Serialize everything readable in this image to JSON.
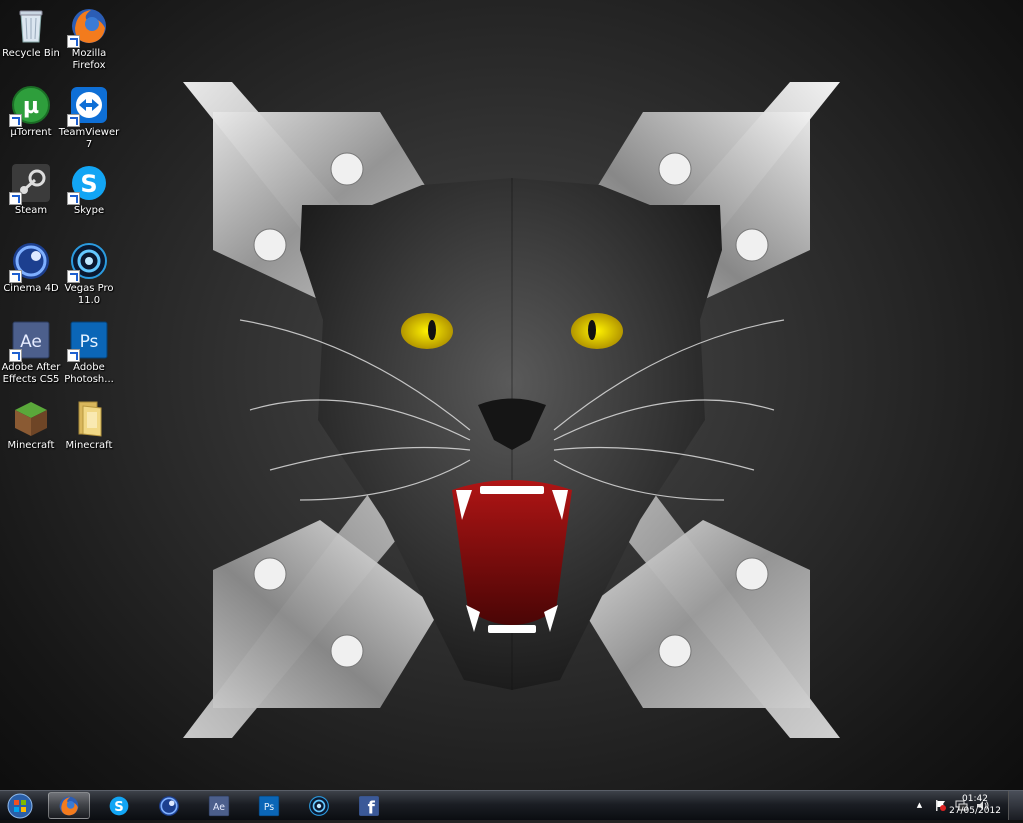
{
  "desktop": {
    "icons": [
      {
        "label": "Recycle Bin",
        "icon": "recycle-bin-icon"
      },
      {
        "label": "Mozilla Firefox",
        "icon": "firefox-icon"
      },
      {
        "label": "µTorrent",
        "icon": "utorrent-icon"
      },
      {
        "label": "TeamViewer 7",
        "icon": "teamviewer-icon"
      },
      {
        "label": "Steam",
        "icon": "steam-icon"
      },
      {
        "label": "Skype",
        "icon": "skype-icon"
      },
      {
        "label": "Cinema 4D",
        "icon": "cinema4d-icon"
      },
      {
        "label": "Vegas Pro 11.0",
        "icon": "vegas-pro-icon"
      },
      {
        "label": "Adobe After Effects CS5",
        "icon": "after-effects-icon"
      },
      {
        "label": "Adobe Photosh...",
        "icon": "photoshop-icon"
      },
      {
        "label": "Minecraft",
        "icon": "minecraft-icon"
      },
      {
        "label": "Minecraft",
        "icon": "folder-icon"
      }
    ]
  },
  "taskbar": {
    "start_icon": "windows-orb-icon",
    "pinned": [
      {
        "name": "firefox",
        "icon": "firefox-icon",
        "active": true
      },
      {
        "name": "skype",
        "icon": "skype-icon",
        "active": false
      },
      {
        "name": "cinema4d",
        "icon": "cinema4d-icon",
        "active": false
      },
      {
        "name": "after-effects",
        "icon": "after-effects-icon",
        "label": "Ae",
        "active": false
      },
      {
        "name": "photoshop",
        "icon": "photoshop-icon",
        "label": "Ps",
        "active": false
      },
      {
        "name": "vegas-pro",
        "icon": "vegas-pro-icon",
        "active": false
      },
      {
        "name": "facebook",
        "icon": "facebook-icon",
        "label": "f",
        "active": false
      }
    ],
    "tray": {
      "arrow": "▲",
      "icons": [
        "flag-icon",
        "network-icon",
        "volume-icon"
      ]
    },
    "clock": {
      "time": "01:42",
      "date": "27/05/2012"
    }
  },
  "colors": {
    "skype": "#12a5f4",
    "photoshop": "#0b66b7",
    "after_effects": "#4c5f8c",
    "utorrent": "#2e9e3c",
    "facebook": "#3b5998",
    "panther_eye": "#e6d400",
    "panther_mouth": "#8c0d0d"
  }
}
